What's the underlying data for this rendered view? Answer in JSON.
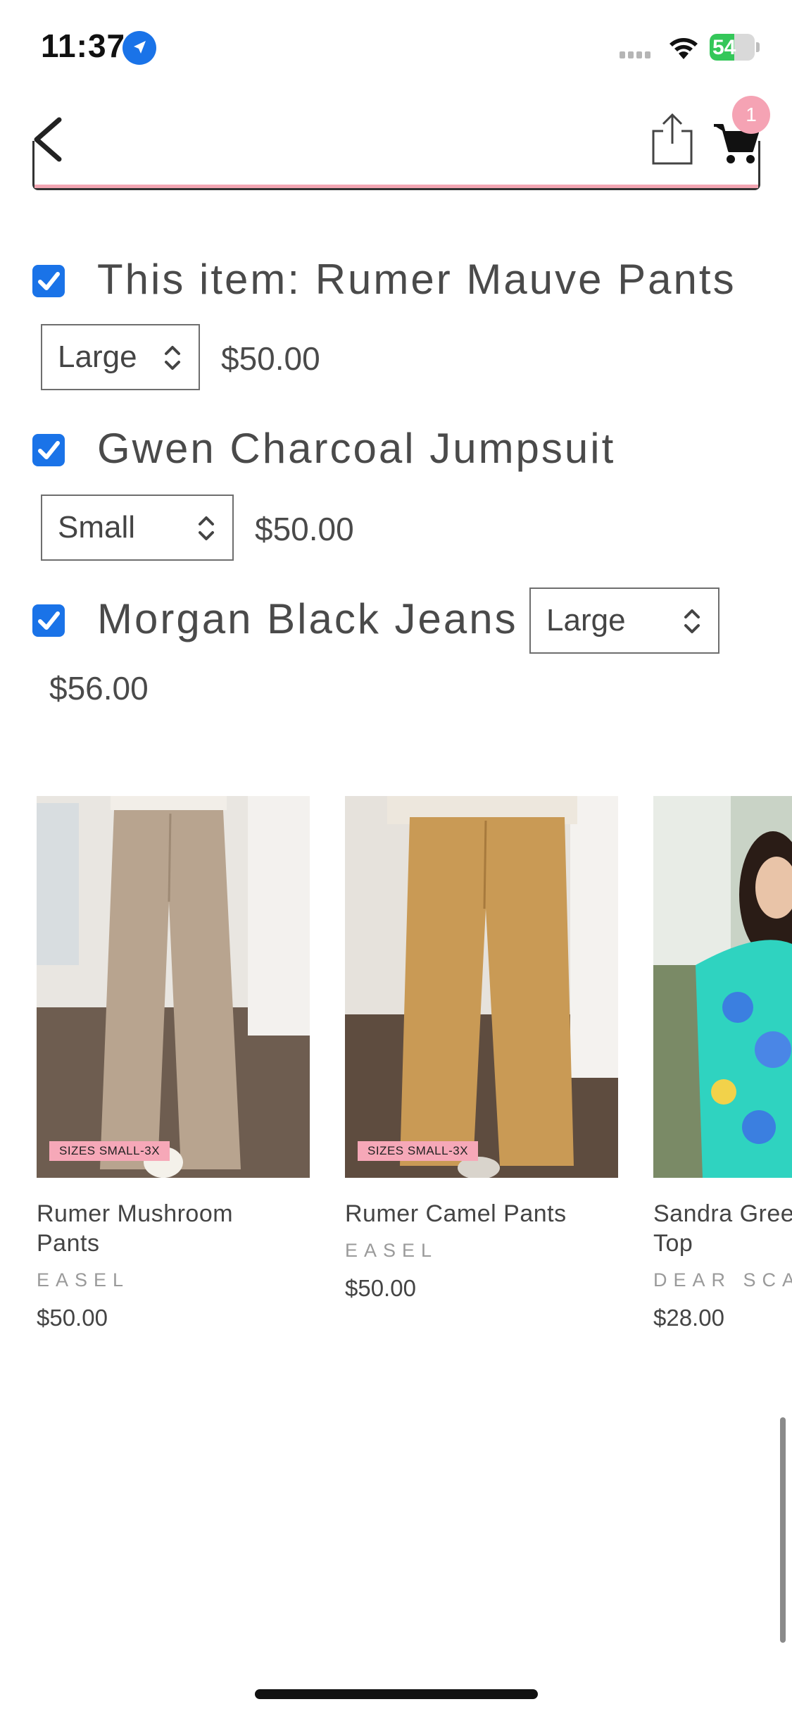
{
  "status_bar": {
    "time": "11:37",
    "battery": "54",
    "battery_level": 0.54
  },
  "nav": {
    "cart_count": "1"
  },
  "bundle": [
    {
      "label": "This item: Rumer Mauve Pants",
      "size": "Large",
      "price": "$50.00",
      "checked": true
    },
    {
      "label": "Gwen Charcoal Jumpsuit",
      "size": "Small",
      "price": "$50.00",
      "checked": true
    },
    {
      "label": "Morgan Black Jeans",
      "size": "Large",
      "price": "$56.00",
      "checked": true
    }
  ],
  "products": [
    {
      "title_line1": "Rumer Mushroom",
      "title_line2": "Pants",
      "brand": "EASEL",
      "price": "$50.00",
      "badge": "SIZES SMALL-3X"
    },
    {
      "title_line1": "Rumer Camel Pants",
      "title_line2": "",
      "brand": "EASEL",
      "price": "$50.00",
      "badge": "SIZES SMALL-3X"
    },
    {
      "title_line1": "Sandra Gree",
      "title_line2": "Top",
      "brand": "DEAR SCA",
      "price": "$28.00",
      "badge": ""
    }
  ],
  "colors": {
    "accent": "#1a73e8",
    "pink": "#f3a6b3",
    "badge": "#f6a8b8"
  }
}
